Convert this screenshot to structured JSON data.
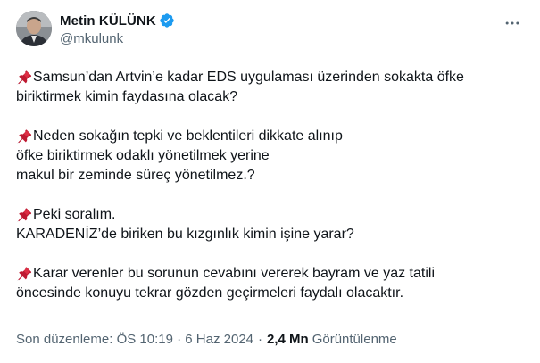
{
  "author": {
    "name": "Metin KÜLÜNK",
    "handle": "@mkulunk"
  },
  "icons": {
    "verified": "verified-badge-icon",
    "more": "more-options-icon",
    "pin": "pushpin-icon"
  },
  "colors": {
    "text": "#0f1419",
    "secondary": "#536471",
    "verified": "#1d9bf0",
    "pin": "#e8433a"
  },
  "tweet": {
    "paragraphs": [
      {
        "pin": true,
        "lines": [
          "Samsun’dan Artvin’e kadar EDS uygulaması üzerinden sokakta öfke",
          "biriktirmek kimin faydasına olacak?"
        ]
      },
      {
        "pin": true,
        "lines": [
          "Neden sokağın tepki ve beklentileri dikkate alınıp",
          "öfke biriktirmek odaklı yönetilmek yerine",
          "makul bir zeminde süreç yönetilmez.?"
        ]
      },
      {
        "pin": true,
        "lines": [
          "Peki soralım.",
          "KARADENİZ’de biriken bu kızgınlık kimin işine yarar?"
        ]
      },
      {
        "pin": true,
        "lines": [
          "Karar verenler bu sorunun cevabını vererek bayram ve yaz tatili",
          "öncesinde konuyu tekrar gözden geçirmeleri faydalı olacaktır."
        ]
      }
    ]
  },
  "meta": {
    "edited_time": "Son düzenleme: ÖS 10:19 · 6 Haz 2024",
    "separator": "·",
    "views_count": "2,4 Mn",
    "views_label": "Görüntülenme"
  }
}
